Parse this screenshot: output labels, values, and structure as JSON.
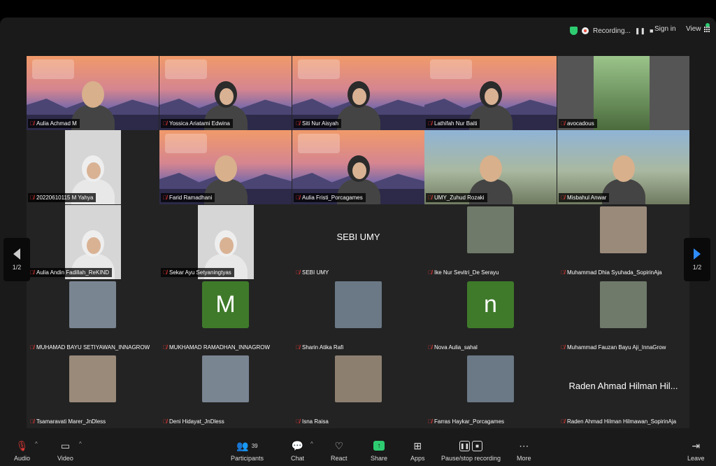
{
  "top_bar": {
    "recording_label": "Recording...",
    "signin_label": "Sign in",
    "view_label": "View"
  },
  "pager": {
    "left_label": "1/2",
    "right_label": "1/2"
  },
  "tiles": [
    {
      "name": "Aulia Achmad M",
      "kind": "banner",
      "figure": "man"
    },
    {
      "name": "Yossica Ariatami Edwina",
      "kind": "banner",
      "figure": "hijab"
    },
    {
      "name": "Siti Nur Aisyah",
      "kind": "banner",
      "figure": "hijab"
    },
    {
      "name": "Lathifah Nur Baiti",
      "kind": "banner",
      "figure": "hijab",
      "active": true
    },
    {
      "name": "avocadous",
      "kind": "photo"
    },
    {
      "name": "20220610115 M Yahya",
      "kind": "camera"
    },
    {
      "name": "Farid Ramadhani",
      "kind": "banner",
      "figure": "man"
    },
    {
      "name": "Aulia Fristi_Porcagames",
      "kind": "banner",
      "figure": "hijab"
    },
    {
      "name": "UMY_Zuhud Rozaki",
      "kind": "video"
    },
    {
      "name": "Misbahul Anwar",
      "kind": "video"
    },
    {
      "name": "Aulia Andin Fadillah_ReKIND",
      "kind": "camera"
    },
    {
      "name": "Sekar Ayu Setyaningtyas",
      "kind": "camera"
    },
    {
      "name": "SEBI UMY",
      "kind": "text",
      "big": "SEBI UMY"
    },
    {
      "name": "Ike Nur Sevitri_De Serayu",
      "kind": "avatar"
    },
    {
      "name": "Muhammad Dhia Syuhada_SopirinAja",
      "kind": "avatar"
    },
    {
      "name": "MUHAMAD BAYU SETIYAWAN_INNAGROW",
      "kind": "avatar"
    },
    {
      "name": "MUKHAMAD RAMADHAN_INNAGROW",
      "kind": "letter",
      "letter": "M"
    },
    {
      "name": "Sharin Atika Rafi",
      "kind": "avatar"
    },
    {
      "name": "Nova Aulia_sahal",
      "kind": "letter",
      "letter": "n"
    },
    {
      "name": "Muhammad Fauzan Bayu Aji_InnaGrow",
      "kind": "avatar"
    },
    {
      "name": "Tsamaravati Marer_JnDless",
      "kind": "avatar"
    },
    {
      "name": "Deni Hidayat_JnDless",
      "kind": "avatar"
    },
    {
      "name": "Isna Raisa",
      "kind": "avatar"
    },
    {
      "name": "Farras Haykar_Porcagames",
      "kind": "avatar"
    },
    {
      "name": "Raden Ahmad Hilman Hilmawan_SopirinAja",
      "kind": "text",
      "big": "Raden Ahmad Hilman Hil..."
    }
  ],
  "toolbar": {
    "audio": "Audio",
    "video": "Video",
    "participants": "Participants",
    "participants_count": "39",
    "chat": "Chat",
    "react": "React",
    "share": "Share",
    "apps": "Apps",
    "pause_stop": "Pause/stop recording",
    "more": "More",
    "leave": "Leave"
  },
  "colors": {
    "accent_green": "#2ecc71",
    "mic_off_red": "#e53935",
    "pager_blue": "#2d8cff",
    "letter_tile_green": "#3f7a2a"
  }
}
